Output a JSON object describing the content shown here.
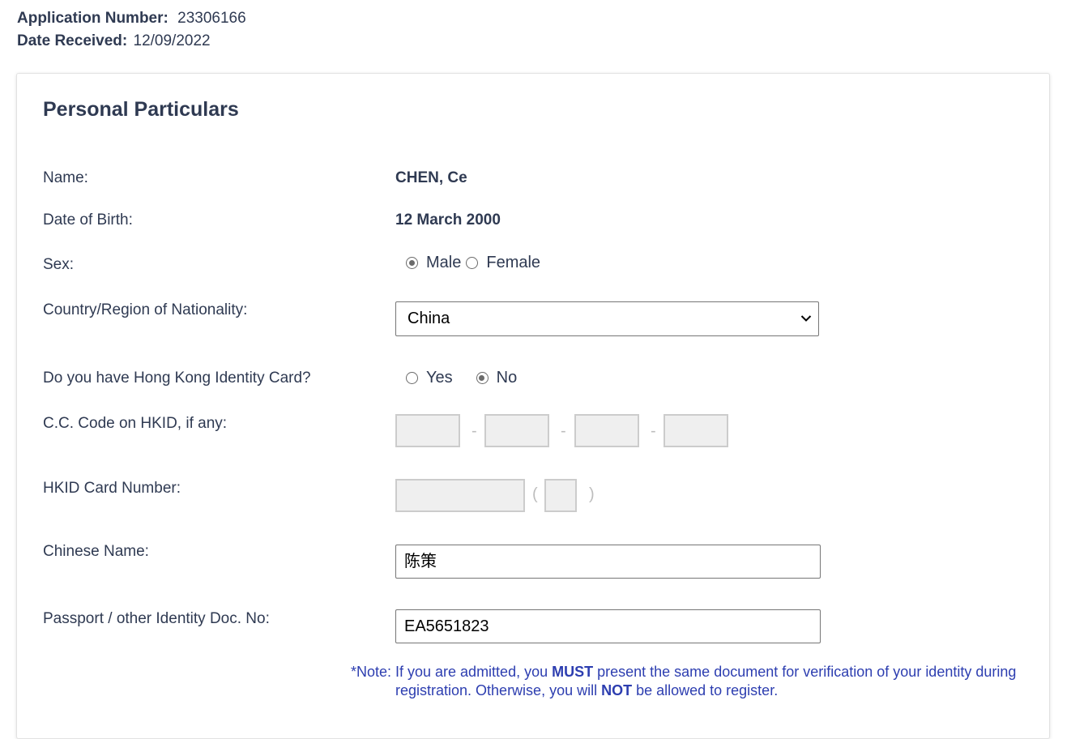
{
  "header": {
    "application_number_label": "Application Number:",
    "application_number_value": "23306166",
    "date_received_label": "Date Received:",
    "date_received_value": "12/09/2022"
  },
  "section": {
    "title": "Personal Particulars"
  },
  "fields": {
    "name_label": "Name:",
    "name_value": "CHEN, Ce",
    "dob_label": "Date of Birth:",
    "dob_value": "12 March 2000",
    "sex_label": "Sex:",
    "sex_options": [
      "Male",
      "Female"
    ],
    "sex_selected": "Male",
    "nationality_label": "Country/Region of Nationality:",
    "nationality_value": "China",
    "hkid_question_label": "Do you have Hong Kong Identity Card?",
    "hkid_options": [
      "Yes",
      "No"
    ],
    "hkid_selected": "No",
    "cc_code_label": "C.C. Code on HKID, if any:",
    "cc_separator": "-",
    "hkid_number_label": "HKID Card Number:",
    "hkid_open_paren": "(",
    "hkid_close_paren": ")",
    "chinese_name_label": "Chinese Name:",
    "chinese_name_value": "陈策",
    "passport_label": "Passport / other Identity Doc. No:",
    "passport_value": "EA5651823"
  },
  "note": {
    "prefix": "*Note:",
    "part1": "If you are admitted, you ",
    "emphasis1": "MUST",
    "part2": " present the same document for verification of your identity during registration. Otherwise, you will ",
    "emphasis2": "NOT",
    "part3": " be allowed to register."
  },
  "colors": {
    "text": "#2f3a52",
    "note": "#2d3eb0",
    "disabled_bg": "#efefef"
  }
}
